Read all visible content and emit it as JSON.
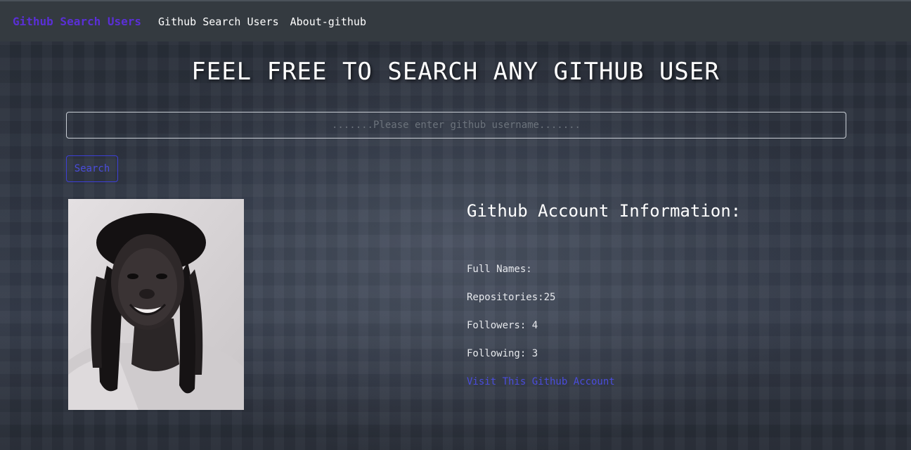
{
  "navbar": {
    "brand": "Github Search Users",
    "links": [
      "Github Search Users",
      "About-github"
    ]
  },
  "main": {
    "title": "FEEL FREE TO SEARCH ANY GITHUB USER",
    "search": {
      "placeholder": ".......Please enter github username.......",
      "value": "",
      "button_label": "Search"
    }
  },
  "profile": {
    "heading": "Github Account Information:",
    "full_names_label": "Full Names:",
    "repositories_label": "Repositories:25",
    "followers_label": "Followers: 4",
    "following_label": "Following: 3",
    "link_label": "Visit This Github Account"
  },
  "colors": {
    "navbar_bg": "#343a40",
    "brand": "#5a2fd6",
    "accent": "#4a4cdc"
  }
}
